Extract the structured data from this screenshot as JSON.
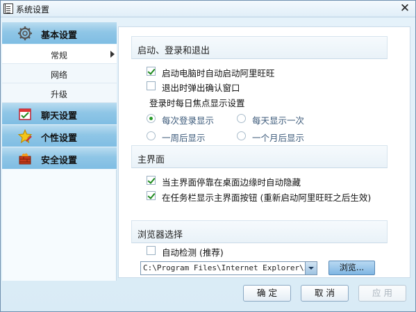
{
  "window": {
    "title": "系统设置"
  },
  "sidebar": {
    "categories": [
      {
        "label": "基本设置",
        "icon": "gear-icon",
        "items": [
          {
            "label": "常规",
            "active": true
          },
          {
            "label": "网络"
          },
          {
            "label": "升级"
          }
        ]
      },
      {
        "label": "聊天设置",
        "icon": "chat-checklist-icon"
      },
      {
        "label": "个性设置",
        "icon": "star-pencil-icon"
      },
      {
        "label": "安全设置",
        "icon": "firewall-icon"
      }
    ]
  },
  "startup": {
    "header": "启动、登录和退出",
    "auto_start": {
      "label": "启动电脑时自动启动阿里旺旺",
      "checked": true
    },
    "exit_confirm": {
      "label": "退出时弹出确认窗口",
      "checked": false
    },
    "daily_focus_label": "登录时每日焦点显示设置",
    "radios": [
      {
        "label": "每次登录显示",
        "checked": true
      },
      {
        "label": "每天显示一次",
        "checked": false
      },
      {
        "label": "一周后显示",
        "checked": false
      },
      {
        "label": "一个月后显示",
        "checked": false
      }
    ]
  },
  "main_ui": {
    "header": "主界面",
    "auto_hide": {
      "label": "当主界面停靠在桌面边缘时自动隐藏",
      "checked": true
    },
    "taskbar_button": {
      "label": "在任务栏显示主界面按钮 (重新启动阿里旺旺之后生效)",
      "checked": true
    }
  },
  "browser": {
    "header": "浏览器选择",
    "auto_detect": {
      "label": "自动检测 (推荐)",
      "checked": false
    },
    "path_value": "C:\\Program Files\\Internet Explorer\\iexp",
    "browse_label": "浏览..."
  },
  "buttons": {
    "ok": "确 定",
    "cancel": "取 消",
    "apply": "应 用"
  },
  "colors": {
    "accent": "#8fc6e6",
    "check": "#1e8a1e"
  }
}
